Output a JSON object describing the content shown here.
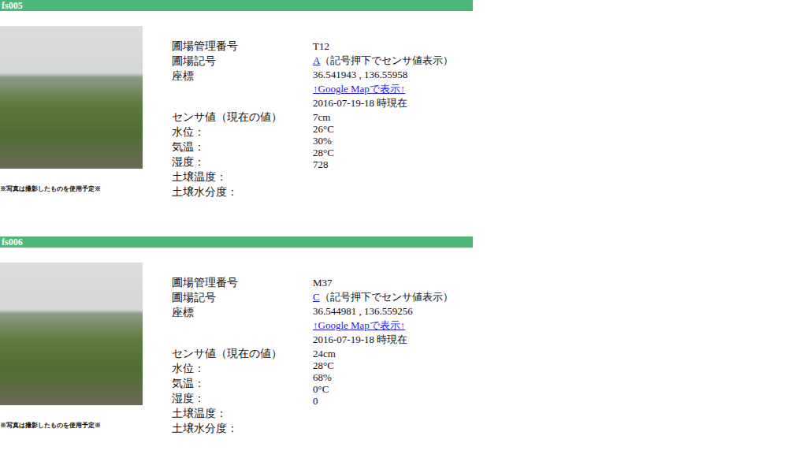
{
  "sections": [
    {
      "header": "fs005",
      "caption": "※写真は撮影したものを使用予定※",
      "info_labels": [
        "圃場管理番号",
        "圃場記号",
        "座標"
      ],
      "sensor_heading": "センサ値（現在の値）",
      "sensor_labels": [
        "水位：",
        "気温：",
        "湿度：",
        "土壌温度：",
        "土壌水分度："
      ],
      "field_no": "T12",
      "symbol": {
        "link": "A",
        "note": "（記号押下でセンサ値表示）"
      },
      "coords": "36.541943 , 136.55958",
      "map_link": "↑Google Mapで表示↑",
      "timestamp": "2016-07-19-18 時現在",
      "sensor_values": [
        "7cm",
        "26°C",
        "30%",
        "28°C",
        "728"
      ]
    },
    {
      "header": "fs006",
      "caption": "※写真は撮影したものを使用予定※",
      "info_labels": [
        "圃場管理番号",
        "圃場記号",
        "座標"
      ],
      "sensor_heading": "センサ値（現在の値）",
      "sensor_labels": [
        "水位：",
        "気温：",
        "湿度：",
        "土壌温度：",
        "土壌水分度："
      ],
      "field_no": "M37",
      "symbol": {
        "link": "C",
        "note": "（記号押下でセンサ値表示）"
      },
      "coords": "36.544981 , 136.559256",
      "map_link": "↑Google Mapで表示↑",
      "timestamp": "2016-07-19-18 時現在",
      "sensor_values": [
        "24cm",
        "28°C",
        "68%",
        "0°C",
        "0"
      ]
    }
  ]
}
